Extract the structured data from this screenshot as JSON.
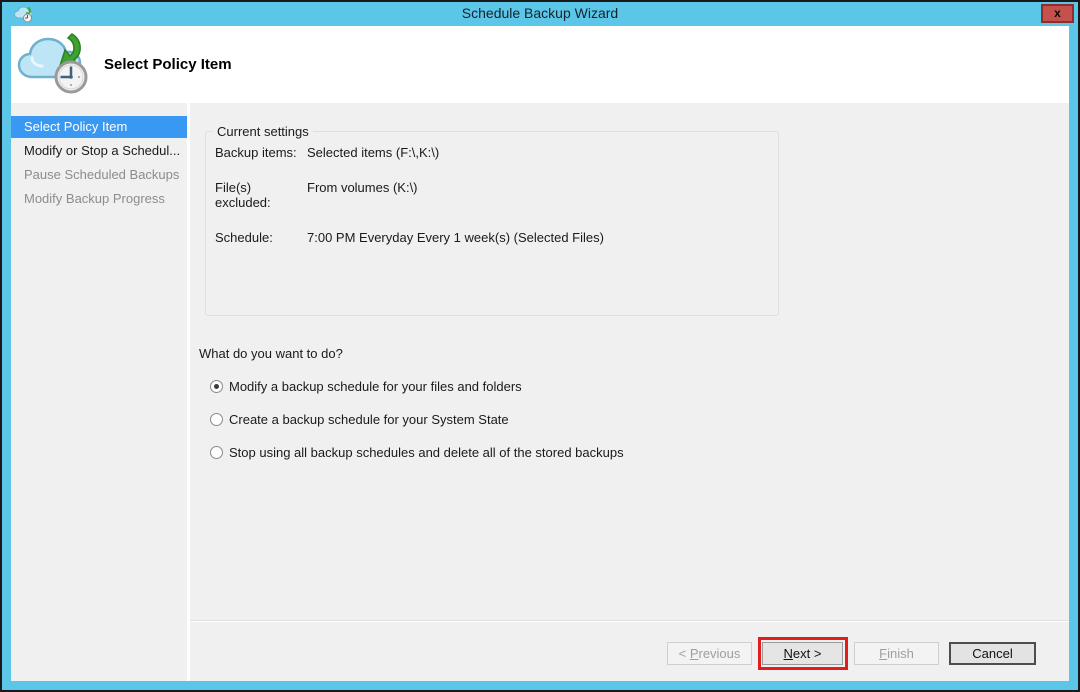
{
  "window": {
    "title": "Schedule Backup Wizard",
    "close_glyph": "x"
  },
  "header": {
    "title": "Select Policy Item"
  },
  "sidebar": {
    "items": [
      {
        "label": "Select Policy Item",
        "state": "selected"
      },
      {
        "label": "Modify or Stop a Schedul...",
        "state": "enabled"
      },
      {
        "label": "Pause Scheduled Backups",
        "state": "disabled"
      },
      {
        "label": "Modify Backup Progress",
        "state": "disabled"
      }
    ]
  },
  "settings": {
    "group_title": "Current settings",
    "rows": [
      {
        "label": "Backup items:",
        "value": "Selected items (F:\\,K:\\)"
      },
      {
        "label": "File(s) excluded:",
        "value": "From volumes (K:\\)"
      },
      {
        "label": "Schedule:",
        "value": "7:00 PM Everyday Every 1 week(s) (Selected Files)"
      }
    ]
  },
  "question": "What do you want to do?",
  "options": [
    {
      "label": "Modify a backup schedule for your files and folders",
      "selected": true
    },
    {
      "label": "Create a backup schedule for your System State",
      "selected": false
    },
    {
      "label": "Stop using all backup schedules and delete all of the stored backups",
      "selected": false
    }
  ],
  "footer": {
    "previous": {
      "pre": "< ",
      "mn": "P",
      "post": "revious",
      "enabled": false
    },
    "next": {
      "pre": "",
      "mn": "N",
      "post": "ext >",
      "enabled": true,
      "highlighted": true
    },
    "finish": {
      "pre": "",
      "mn": "F",
      "post": "inish",
      "enabled": false
    },
    "cancel": {
      "label": "Cancel",
      "enabled": true
    }
  },
  "colors": {
    "titlebar": "#5bc6e8",
    "selected_step": "#3898f2",
    "highlight_annotation": "#e01e1e",
    "close_button": "#c4514d"
  }
}
